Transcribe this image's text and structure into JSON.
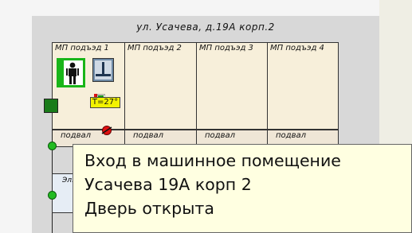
{
  "building": {
    "address": "ул. Усачева, д.19А корп.2"
  },
  "entrances": [
    {
      "label": "МП подъэд 1"
    },
    {
      "label": "МП подъэд 2"
    },
    {
      "label": "МП подъэд 3"
    },
    {
      "label": "МП подъэд 4"
    }
  ],
  "basements": [
    {
      "label": "подвал"
    },
    {
      "label": "подвал"
    },
    {
      "label": "подвал"
    },
    {
      "label": "подвал"
    }
  ],
  "lower_room": {
    "label": "Эл."
  },
  "temperature": {
    "text": "T=27°"
  },
  "tooltip": {
    "line1": "Вход в машинное помещение",
    "line2": "Усачева 19А корп 2",
    "line3": "Дверь открыта"
  },
  "colors": {
    "status_ok": "#22bb22",
    "status_alarm": "#e01010",
    "temp_badge": "#f2f200",
    "tooltip_bg": "#ffffe1"
  }
}
